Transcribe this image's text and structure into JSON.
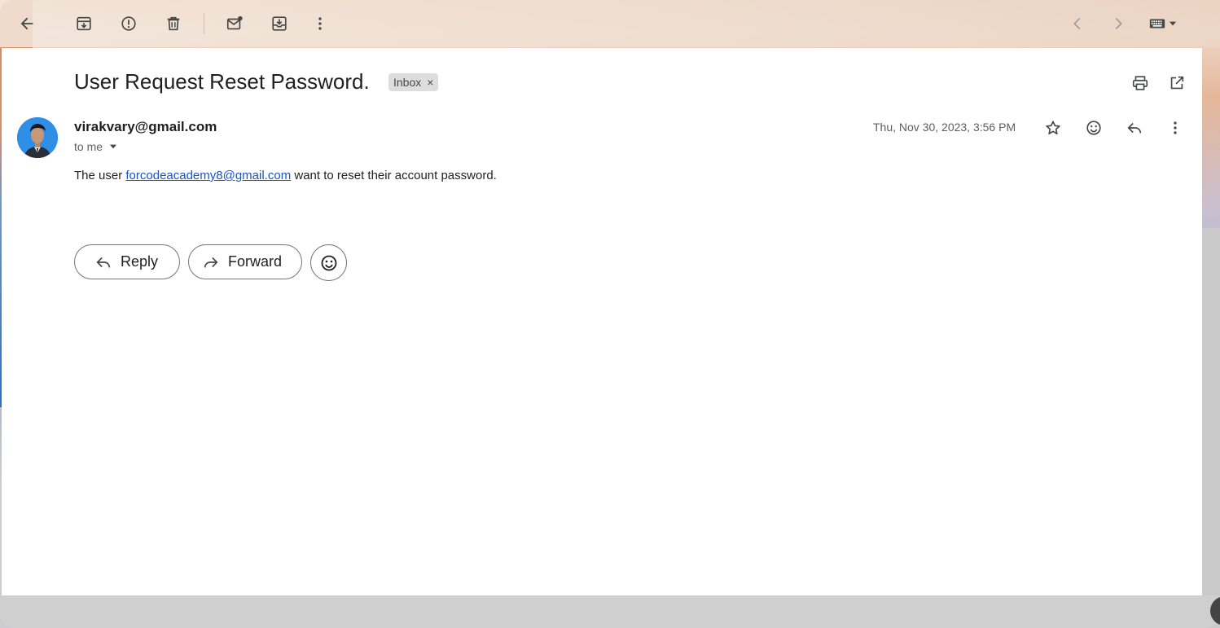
{
  "toolbar": {
    "back": "back-arrow-icon",
    "archive": "archive-icon",
    "spam": "report-spam-icon",
    "delete": "trash-icon",
    "mark_unread": "mark-unread-icon",
    "move_to": "move-to-inbox-icon",
    "more": "more-vert-icon",
    "prev": "chevron-left-icon",
    "next": "chevron-right-icon",
    "keyboard": "keyboard-icon"
  },
  "message": {
    "subject": "User Request Reset Password.",
    "label": "Inbox",
    "label_close": "×",
    "sender": "virakvary@gmail.com",
    "to": "to me",
    "date": "Thu, Nov 30, 2023, 3:56 PM",
    "body_prefix": "The user ",
    "body_link": "forcodeacademy8@gmail.com",
    "body_suffix": " want to reset their account password."
  },
  "actions": {
    "reply": "Reply",
    "forward": "Forward"
  },
  "colors": {
    "link": "#1a55c4",
    "avatar_bg": "#2f8fe6"
  }
}
